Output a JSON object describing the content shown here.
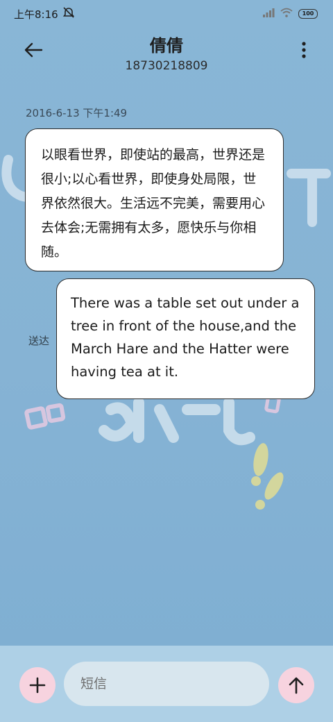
{
  "status_bar": {
    "time": "上午8:16",
    "icons": [
      "alarm-off-icon",
      "signal-icon",
      "wifi-icon",
      "battery-icon"
    ],
    "battery_level": "100"
  },
  "header": {
    "contact_name": "倩倩",
    "contact_number": "18730218809",
    "back_icon": "arrow-left-icon",
    "menu_icon": "more-vertical-icon"
  },
  "conversation": {
    "timestamp": "2016-6-13 下午1:49",
    "incoming_message": "以眼看世界，即使站的最高，世界还是很小;以心看世界，即使身处局限，世界依然很大。生活远不完美，需要用心去体会;无需拥有太多，愿快乐与你相随。",
    "outgoing_message": "There was a table set out under a tree in front of the house,and the March Hare and the Hatter were having tea at it.",
    "delivery_status": "送达"
  },
  "composer": {
    "add_icon": "plus-icon",
    "placeholder": "短信",
    "send_icon": "arrow-up-icon"
  },
  "colors": {
    "background": "#86b3d4",
    "composer_bar": "#aed0e6",
    "button_bg": "#f7d3df",
    "input_bg": "#d8e6ee"
  }
}
